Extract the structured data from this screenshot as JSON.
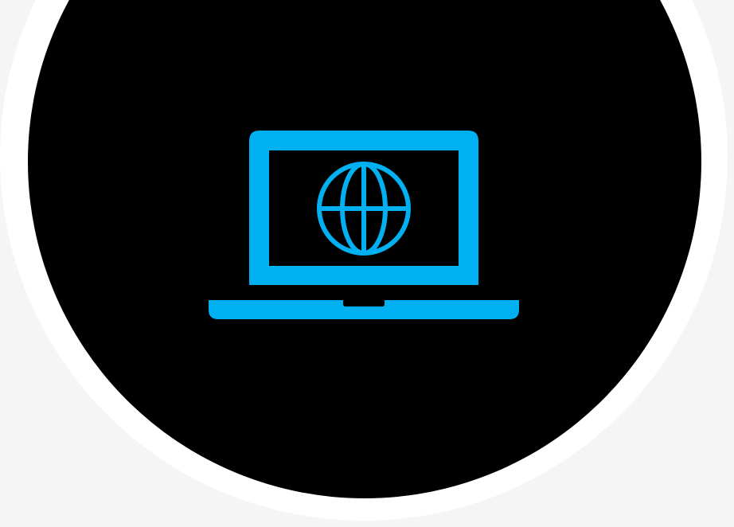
{
  "colors": {
    "page_background": "#f5f5f5",
    "ring": "#ffffff",
    "disc": "#000000",
    "icon": "#00b0f0"
  },
  "icon": {
    "name": "laptop-globe-icon"
  }
}
